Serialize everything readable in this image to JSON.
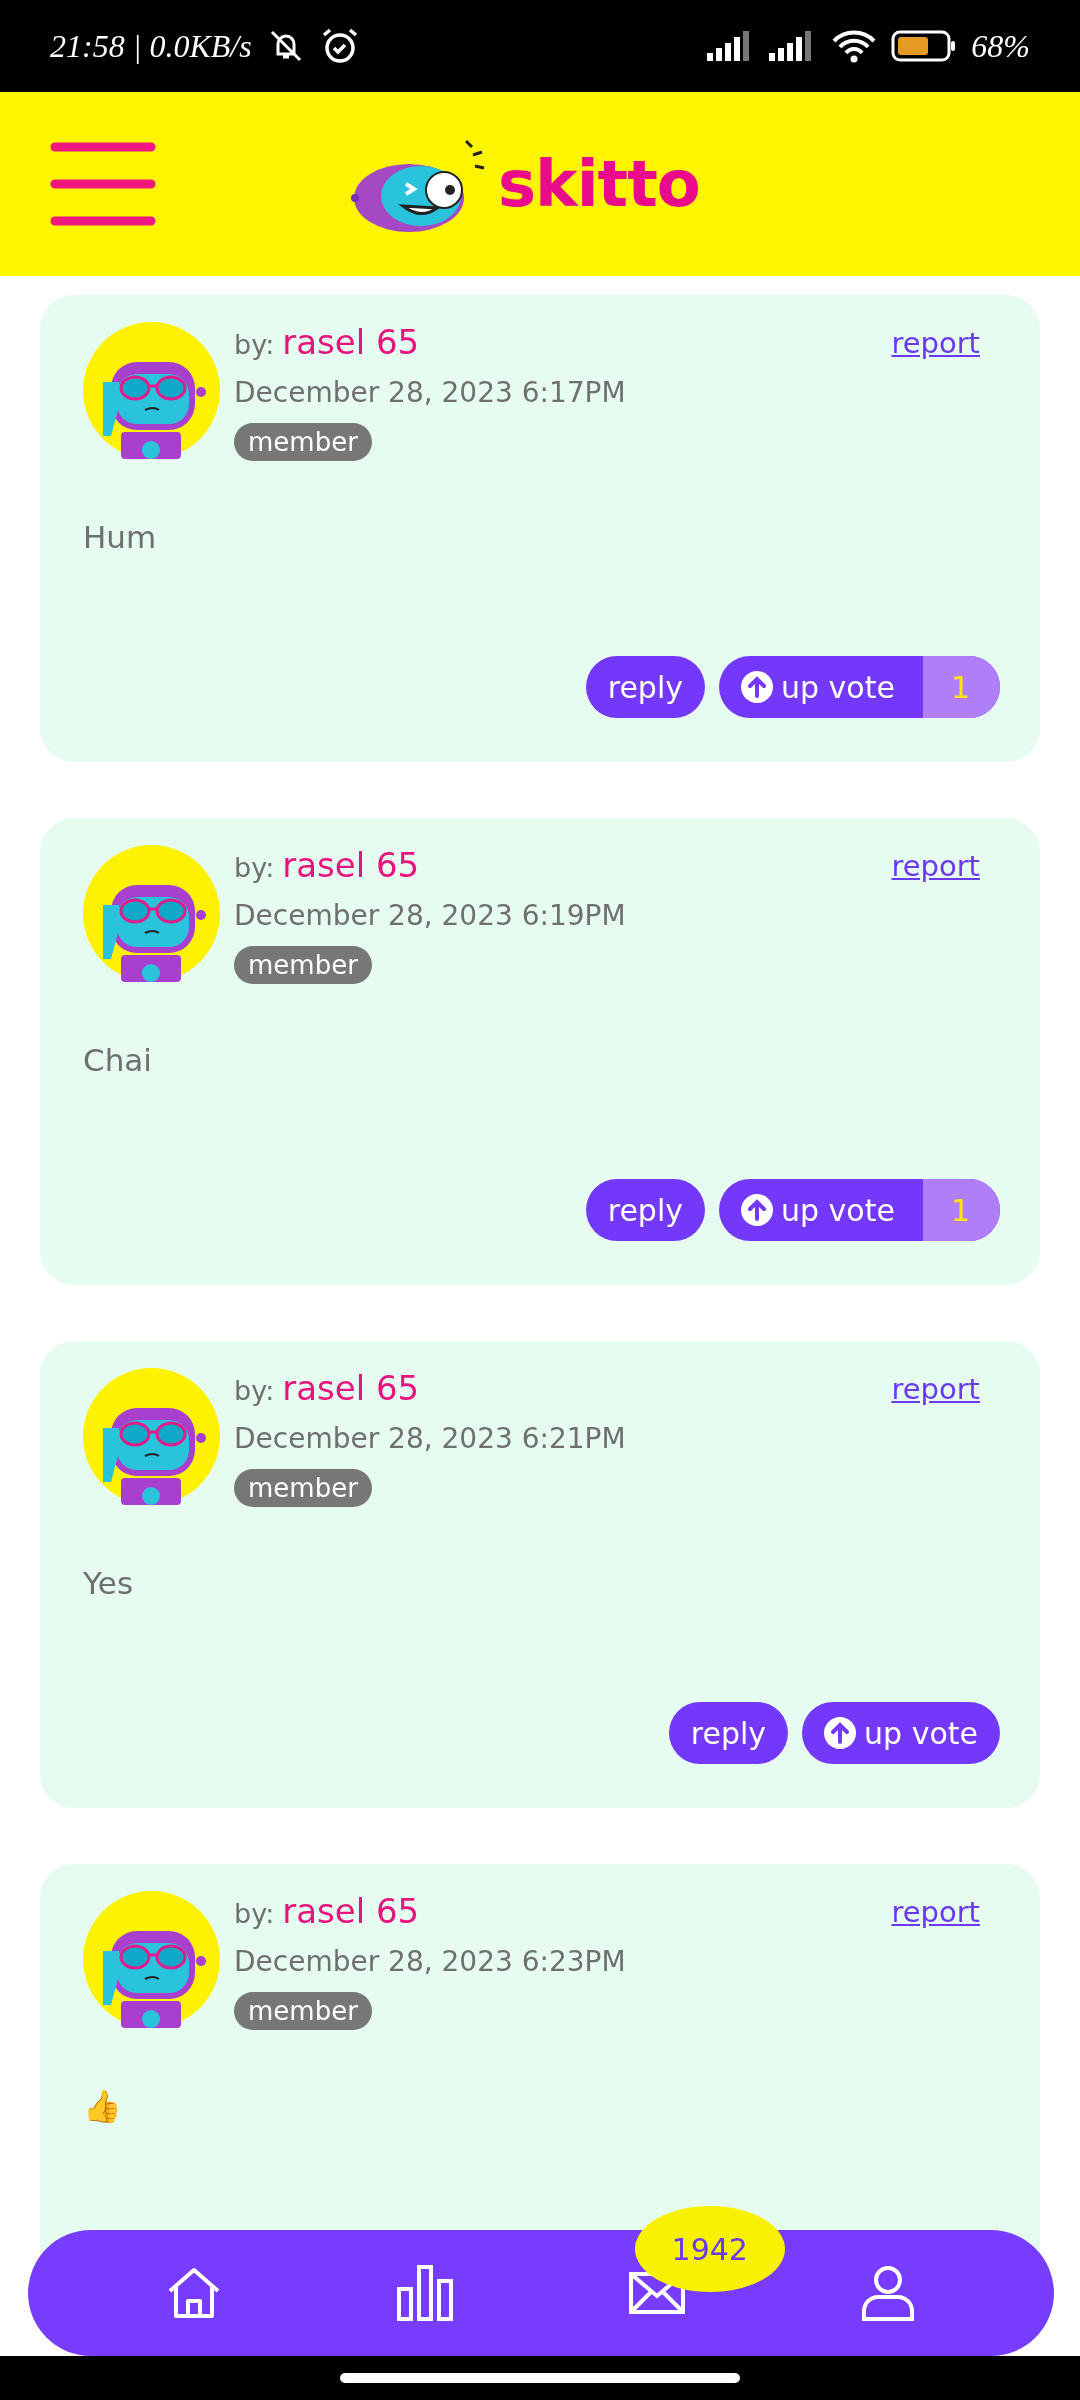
{
  "status_bar": {
    "time_speed": "21:58 | 0.0KB/s",
    "battery": "68%"
  },
  "header": {
    "logo_text": "skitto"
  },
  "posts": [
    {
      "by_label": "by:",
      "author": "rasel 65",
      "date": "December 28, 2023 6:17PM",
      "role": "member",
      "report": "report",
      "body": "Hum",
      "reply": "reply",
      "upvote": "up vote",
      "vote_count": "1"
    },
    {
      "by_label": "by:",
      "author": "rasel 65",
      "date": "December 28, 2023 6:19PM",
      "role": "member",
      "report": "report",
      "body": "Chai",
      "reply": "reply",
      "upvote": "up vote",
      "vote_count": "1"
    },
    {
      "by_label": "by:",
      "author": "rasel 65",
      "date": "December 28, 2023 6:21PM",
      "role": "member",
      "report": "report",
      "body": "Yes",
      "reply": "reply",
      "upvote": "up vote"
    },
    {
      "by_label": "by:",
      "author": "rasel 65",
      "date": "December 28, 2023 6:23PM",
      "role": "member",
      "report": "report",
      "body": "👍"
    }
  ],
  "bottom_nav": {
    "items": [
      {
        "kind": "home"
      },
      {
        "kind": "chart"
      },
      {
        "kind": "mail",
        "badge": "1942"
      },
      {
        "kind": "profile"
      }
    ]
  }
}
